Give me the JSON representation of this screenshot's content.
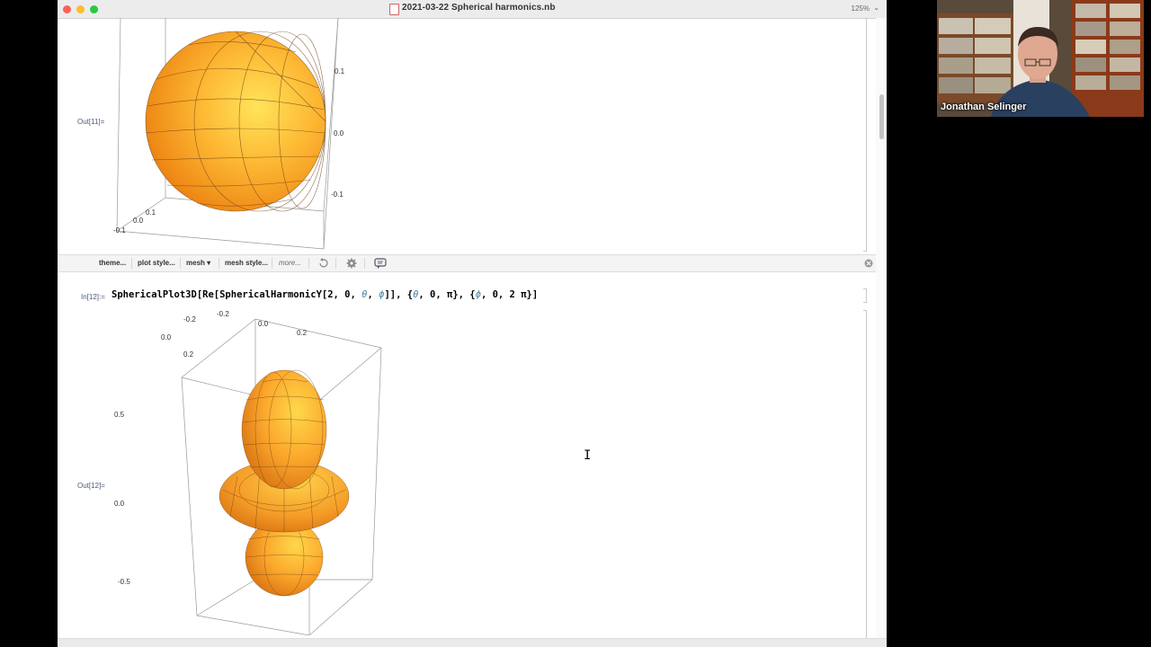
{
  "window": {
    "title": "2021-03-22 Spherical harmonics.nb",
    "zoom": "125%",
    "zoom_caret": "⌄",
    "colors": {
      "close": "#ff5f57",
      "minimize": "#febc2e",
      "maximize": "#28c840"
    }
  },
  "cells": {
    "out11": {
      "label": "Out[11]=",
      "axis_ticks_right": [
        "0.1",
        "0.0",
        "-0.1"
      ],
      "axis_ticks_bottom": [
        "0.1",
        "0.0",
        "-0.1"
      ]
    },
    "in12": {
      "label": "In[12]:=",
      "code": {
        "p1": "SphericalPlot3D[Re[SphericalHarmonicY[2, 0, ",
        "theta1": "θ",
        "p2": ", ",
        "phi1": "ϕ",
        "p3": "]], {",
        "theta2": "θ",
        "p4": ", 0, π}, {",
        "phi2": "ϕ",
        "p5": ", 0, 2 π}]"
      }
    },
    "out12": {
      "label": "Out[12]=",
      "axis_ticks_top": [
        "0.2",
        "0.0",
        "-0.2",
        "-0.2",
        "0.0",
        "0.2"
      ],
      "axis_ticks_left": [
        "0.5",
        "0.0",
        "-0.5"
      ]
    }
  },
  "suggestions_bar": {
    "items": [
      "theme...",
      "plot style...",
      "mesh ▾",
      "mesh style...",
      "more..."
    ]
  },
  "video": {
    "speaker": "Jonathan Selinger"
  },
  "surface_color": "#f5a623"
}
